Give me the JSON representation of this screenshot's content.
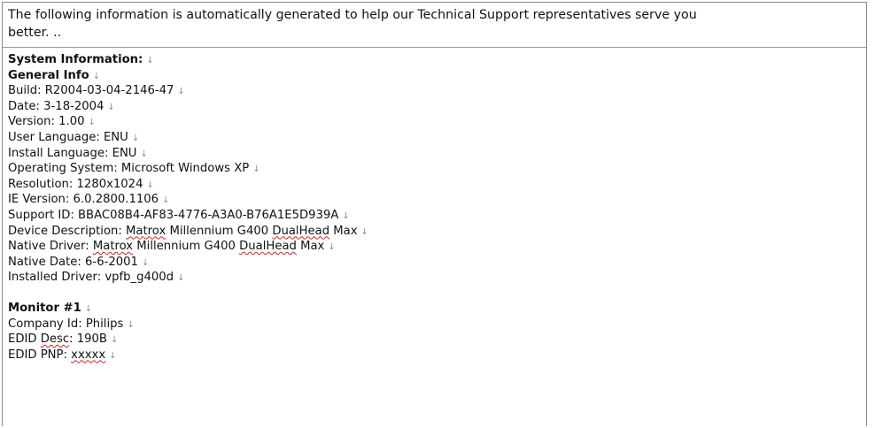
{
  "intro": {
    "line1": "The following information is automatically generated to help our Technical Support representatives serve you",
    "line2": "better. .."
  },
  "paragraph_mark": "↓",
  "system_info": {
    "heading": "System Information:",
    "general_heading": "General Info",
    "build": "Build: R2004-03-04-2146-47",
    "date": "Date: 3-18-2004",
    "version": "Version: 1.00",
    "user_language": "User Language: ENU",
    "install_language": "Install Language: ENU",
    "os": "Operating System: Microsoft Windows XP",
    "resolution": "Resolution: 1280x1024",
    "ie_version": "IE Version: 6.0.2800.1106",
    "support_id": "Support ID: BBAC08B4-AF83-4776-A3A0-B76A1E5D939A",
    "device_desc": {
      "prefix": "Device Description: ",
      "word1": "Matrox",
      "middle": " Millennium G400 ",
      "word2": "DualHead",
      "suffix": " Max"
    },
    "native_driver": {
      "prefix": "Native Driver: ",
      "word1": "Matrox",
      "middle": " Millennium G400 ",
      "word2": "DualHead",
      "suffix": " Max"
    },
    "native_date": "Native Date: 6-6-2001",
    "installed_driver": "Installed Driver: vpfb_g400d"
  },
  "monitor": {
    "heading": "Monitor #1",
    "company_id": "Company Id: Philips",
    "edid_desc": {
      "prefix": "EDID ",
      "word": "Desc",
      "suffix": ": 190B"
    },
    "edid_pnp": {
      "prefix": "EDID PNP: ",
      "word": "xxxxx"
    }
  }
}
